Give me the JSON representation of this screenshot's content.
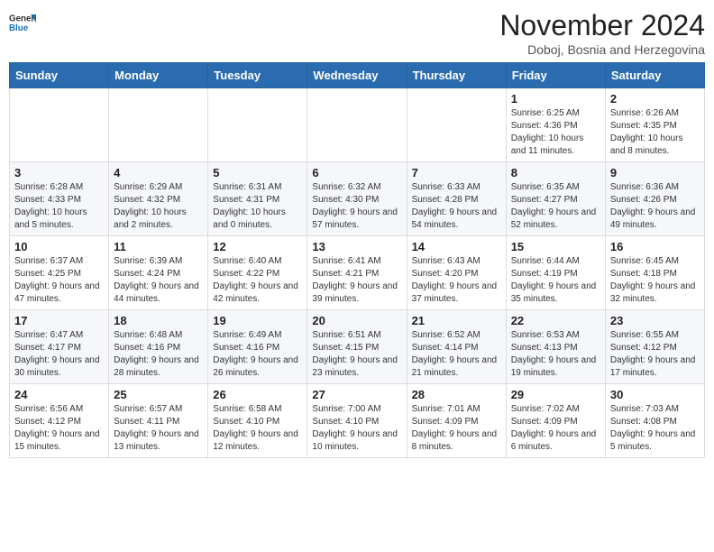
{
  "header": {
    "logo_general": "General",
    "logo_blue": "Blue",
    "month_title": "November 2024",
    "subtitle": "Doboj, Bosnia and Herzegovina"
  },
  "days_of_week": [
    "Sunday",
    "Monday",
    "Tuesday",
    "Wednesday",
    "Thursday",
    "Friday",
    "Saturday"
  ],
  "weeks": [
    [
      {
        "day": "",
        "info": ""
      },
      {
        "day": "",
        "info": ""
      },
      {
        "day": "",
        "info": ""
      },
      {
        "day": "",
        "info": ""
      },
      {
        "day": "",
        "info": ""
      },
      {
        "day": "1",
        "info": "Sunrise: 6:25 AM\nSunset: 4:36 PM\nDaylight: 10 hours and 11 minutes."
      },
      {
        "day": "2",
        "info": "Sunrise: 6:26 AM\nSunset: 4:35 PM\nDaylight: 10 hours and 8 minutes."
      }
    ],
    [
      {
        "day": "3",
        "info": "Sunrise: 6:28 AM\nSunset: 4:33 PM\nDaylight: 10 hours and 5 minutes."
      },
      {
        "day": "4",
        "info": "Sunrise: 6:29 AM\nSunset: 4:32 PM\nDaylight: 10 hours and 2 minutes."
      },
      {
        "day": "5",
        "info": "Sunrise: 6:31 AM\nSunset: 4:31 PM\nDaylight: 10 hours and 0 minutes."
      },
      {
        "day": "6",
        "info": "Sunrise: 6:32 AM\nSunset: 4:30 PM\nDaylight: 9 hours and 57 minutes."
      },
      {
        "day": "7",
        "info": "Sunrise: 6:33 AM\nSunset: 4:28 PM\nDaylight: 9 hours and 54 minutes."
      },
      {
        "day": "8",
        "info": "Sunrise: 6:35 AM\nSunset: 4:27 PM\nDaylight: 9 hours and 52 minutes."
      },
      {
        "day": "9",
        "info": "Sunrise: 6:36 AM\nSunset: 4:26 PM\nDaylight: 9 hours and 49 minutes."
      }
    ],
    [
      {
        "day": "10",
        "info": "Sunrise: 6:37 AM\nSunset: 4:25 PM\nDaylight: 9 hours and 47 minutes."
      },
      {
        "day": "11",
        "info": "Sunrise: 6:39 AM\nSunset: 4:24 PM\nDaylight: 9 hours and 44 minutes."
      },
      {
        "day": "12",
        "info": "Sunrise: 6:40 AM\nSunset: 4:22 PM\nDaylight: 9 hours and 42 minutes."
      },
      {
        "day": "13",
        "info": "Sunrise: 6:41 AM\nSunset: 4:21 PM\nDaylight: 9 hours and 39 minutes."
      },
      {
        "day": "14",
        "info": "Sunrise: 6:43 AM\nSunset: 4:20 PM\nDaylight: 9 hours and 37 minutes."
      },
      {
        "day": "15",
        "info": "Sunrise: 6:44 AM\nSunset: 4:19 PM\nDaylight: 9 hours and 35 minutes."
      },
      {
        "day": "16",
        "info": "Sunrise: 6:45 AM\nSunset: 4:18 PM\nDaylight: 9 hours and 32 minutes."
      }
    ],
    [
      {
        "day": "17",
        "info": "Sunrise: 6:47 AM\nSunset: 4:17 PM\nDaylight: 9 hours and 30 minutes."
      },
      {
        "day": "18",
        "info": "Sunrise: 6:48 AM\nSunset: 4:16 PM\nDaylight: 9 hours and 28 minutes."
      },
      {
        "day": "19",
        "info": "Sunrise: 6:49 AM\nSunset: 4:16 PM\nDaylight: 9 hours and 26 minutes."
      },
      {
        "day": "20",
        "info": "Sunrise: 6:51 AM\nSunset: 4:15 PM\nDaylight: 9 hours and 23 minutes."
      },
      {
        "day": "21",
        "info": "Sunrise: 6:52 AM\nSunset: 4:14 PM\nDaylight: 9 hours and 21 minutes."
      },
      {
        "day": "22",
        "info": "Sunrise: 6:53 AM\nSunset: 4:13 PM\nDaylight: 9 hours and 19 minutes."
      },
      {
        "day": "23",
        "info": "Sunrise: 6:55 AM\nSunset: 4:12 PM\nDaylight: 9 hours and 17 minutes."
      }
    ],
    [
      {
        "day": "24",
        "info": "Sunrise: 6:56 AM\nSunset: 4:12 PM\nDaylight: 9 hours and 15 minutes."
      },
      {
        "day": "25",
        "info": "Sunrise: 6:57 AM\nSunset: 4:11 PM\nDaylight: 9 hours and 13 minutes."
      },
      {
        "day": "26",
        "info": "Sunrise: 6:58 AM\nSunset: 4:10 PM\nDaylight: 9 hours and 12 minutes."
      },
      {
        "day": "27",
        "info": "Sunrise: 7:00 AM\nSunset: 4:10 PM\nDaylight: 9 hours and 10 minutes."
      },
      {
        "day": "28",
        "info": "Sunrise: 7:01 AM\nSunset: 4:09 PM\nDaylight: 9 hours and 8 minutes."
      },
      {
        "day": "29",
        "info": "Sunrise: 7:02 AM\nSunset: 4:09 PM\nDaylight: 9 hours and 6 minutes."
      },
      {
        "day": "30",
        "info": "Sunrise: 7:03 AM\nSunset: 4:08 PM\nDaylight: 9 hours and 5 minutes."
      }
    ]
  ]
}
